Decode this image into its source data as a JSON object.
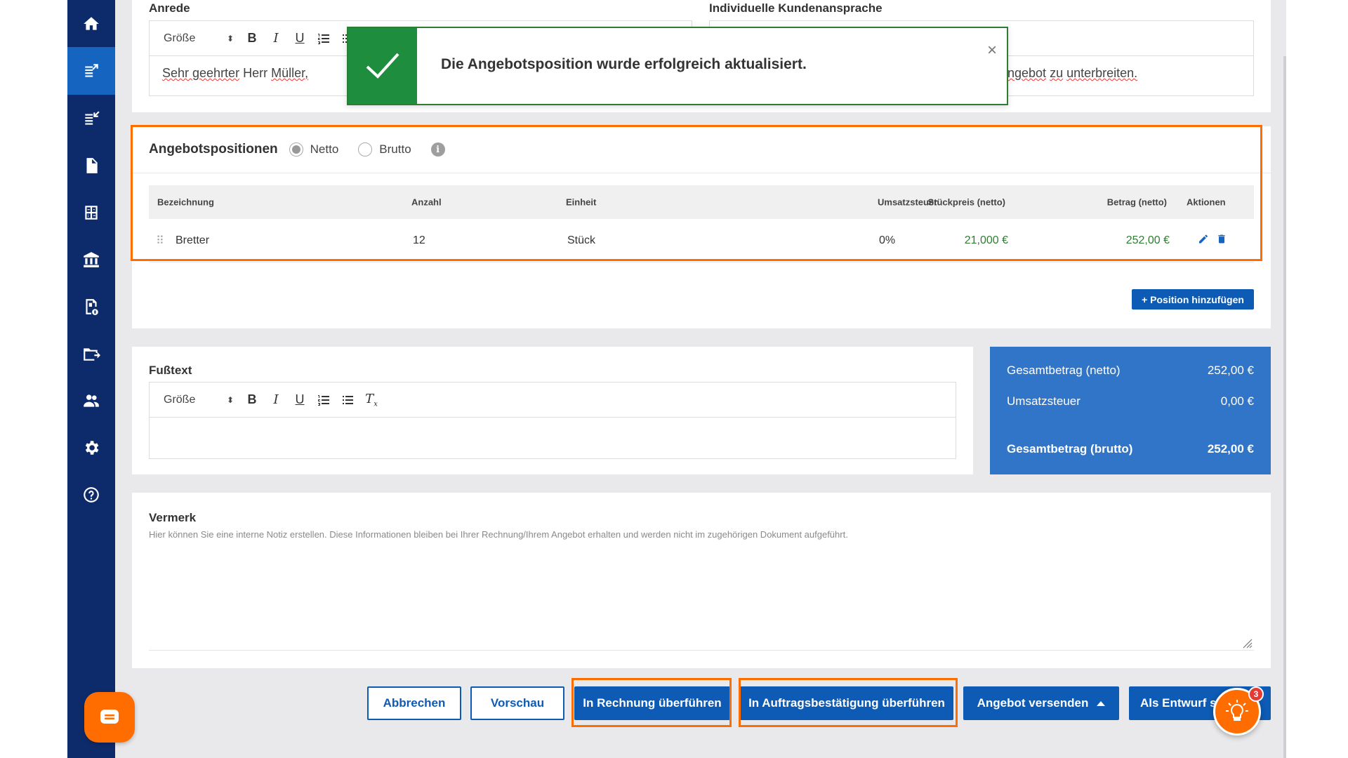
{
  "sidebar": {
    "items": [
      {
        "icon": "home-icon"
      },
      {
        "icon": "offer-out-icon",
        "active": true
      },
      {
        "icon": "offer-in-icon"
      },
      {
        "icon": "document-icon"
      },
      {
        "icon": "calculator-icon"
      },
      {
        "icon": "bank-icon"
      },
      {
        "icon": "receipt-icon"
      },
      {
        "icon": "folder-export-icon"
      },
      {
        "icon": "users-icon"
      },
      {
        "icon": "settings-icon"
      },
      {
        "icon": "help-icon"
      }
    ]
  },
  "salutation": {
    "label": "Anrede",
    "size_label": "Größe",
    "text_prefix": "Sehr geehrter",
    "text_rest": "Herr",
    "text_name": "Müller,"
  },
  "customer_address": {
    "label": "Individuelle Kundenansprache",
    "text_fragment_1": "ngebot",
    "text_fragment_2": "zu",
    "text_fragment_3": "unterbreiten."
  },
  "toast": {
    "message": "Die Angebotsposition wurde erfolgreich aktualisiert.",
    "close": "×"
  },
  "positions": {
    "title": "Angebotspositionen",
    "netto": "Netto",
    "brutto": "Brutto",
    "info": "i",
    "columns": {
      "name": "Bezeichnung",
      "qty": "Anzahl",
      "unit": "Einheit",
      "price": "Stückpreis (netto)",
      "vat": "Umsatzsteuer",
      "amount": "Betrag (netto)",
      "actions": "Aktionen"
    },
    "rows": [
      {
        "name": "Bretter",
        "qty": "12",
        "unit": "Stück",
        "price": "21,000 €",
        "vat": "0%",
        "amount": "252,00 €"
      }
    ],
    "add_button": "+ Position hinzufügen"
  },
  "footer_text": {
    "label": "Fußtext",
    "size_label": "Größe"
  },
  "totals": {
    "net_label": "Gesamtbetrag (netto)",
    "net_value": "252,00 €",
    "vat_label": "Umsatzsteuer",
    "vat_value": "0,00 €",
    "gross_label": "Gesamtbetrag (brutto)",
    "gross_value": "252,00 €"
  },
  "note": {
    "label": "Vermerk",
    "description": "Hier können Sie eine interne Notiz erstellen. Diese Informationen bleiben bei Ihrer Rechnung/Ihrem Angebot erhalten und werden nicht im zugehörigen Dokument aufgeführt."
  },
  "actions": {
    "cancel": "Abbrechen",
    "preview": "Vorschau",
    "to_invoice": "In Rechnung überführen",
    "to_order": "In Auftragsbestätigung überführen",
    "send": "Angebot versenden",
    "draft": "Als Entwurf s"
  },
  "idea_badge": "3",
  "colors": {
    "sidebar": "#0d2b6b",
    "primary": "#0d5bb5",
    "highlight": "#ff6d00",
    "success": "#1e8e3e",
    "totals": "#3075c8"
  }
}
